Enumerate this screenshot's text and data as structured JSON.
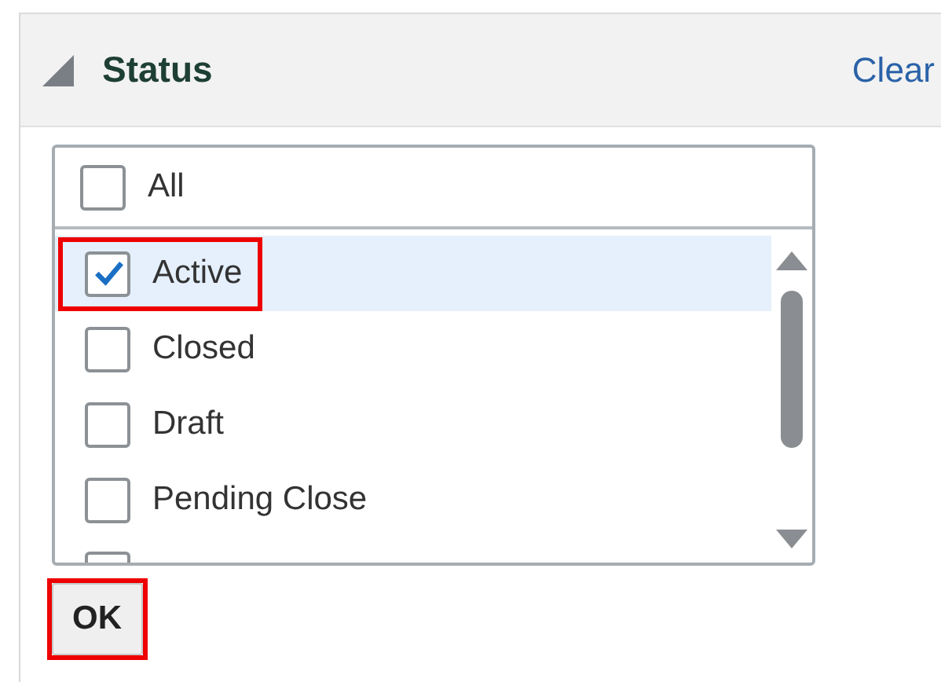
{
  "panel": {
    "title": "Status",
    "expanded": true,
    "clear_link": "Clear"
  },
  "select_all": {
    "label": "All",
    "checked": false
  },
  "options": [
    {
      "label": "Active",
      "checked": true,
      "selected": true,
      "annotated": true
    },
    {
      "label": "Closed",
      "checked": false,
      "selected": false,
      "annotated": false
    },
    {
      "label": "Draft",
      "checked": false,
      "selected": false,
      "annotated": false
    },
    {
      "label": "Pending Close",
      "checked": false,
      "selected": false,
      "annotated": false
    }
  ],
  "ok_button": {
    "label": "OK",
    "annotated": true
  }
}
